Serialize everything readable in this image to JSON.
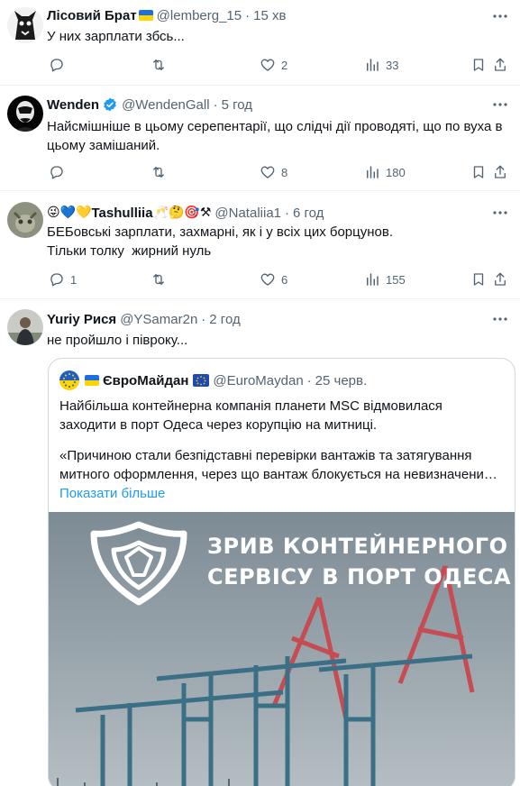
{
  "tweets": [
    {
      "name": "Лісовий Брат",
      "handle": "@lemberg_15",
      "time": "15 хв",
      "text_lines": [
        "У них зарплати збсь..."
      ],
      "replies": "",
      "reposts": "",
      "likes": "2",
      "views": "33"
    },
    {
      "name": "Wenden",
      "handle": "@WendenGall",
      "time": "5 год",
      "text_lines": [
        "Найсмішніше в цьому серепентарії, що слідчі дії проводяті, що по вуха в",
        "цьому замішаний."
      ],
      "replies": "",
      "reposts": "",
      "likes": "8",
      "views": "180"
    },
    {
      "name_prefix": "😜💙💛",
      "name": "Tashulliia",
      "name_suffix": "🥂🤔🎯⚒",
      "handle": "@Nataliia1",
      "time": "6 год",
      "text_lines": [
        "БЕБовські зарплати, захмарні, як і у всіх цих борцунов.",
        "Тільки толку  жирний нуль"
      ],
      "replies": "1",
      "reposts": "",
      "likes": "6",
      "views": "155"
    },
    {
      "name": "Yuriy Рися",
      "handle": "@YSamar2n",
      "time": "2 год",
      "text_lines": [
        "не пройшло і півроку..."
      ]
    }
  ],
  "quote": {
    "name": "ЄвроМайдан",
    "handle": "@EuroMaydan",
    "time": "25 черв.",
    "para1": [
      "Найбільша контейнерна компанія планети MSC відмовилася",
      "заходити в порт Одеса через корупцію на митниці."
    ],
    "para2": [
      "«Причиною стали безпідставні перевірки вантажів та затягування",
      "митного оформлення, через що вантаж блокується на невизначени…"
    ],
    "show_more": "Показати більше",
    "media_title_lines": [
      "ЗРИВ КОНТЕЙНЕРНОГО",
      "СЕРВІСУ В ПОРТ ОДЕСА"
    ]
  },
  "separator": "·",
  "colors": {
    "accent": "#1d9bf0",
    "secondary": "#536471",
    "verified": "#1d9bf0"
  }
}
